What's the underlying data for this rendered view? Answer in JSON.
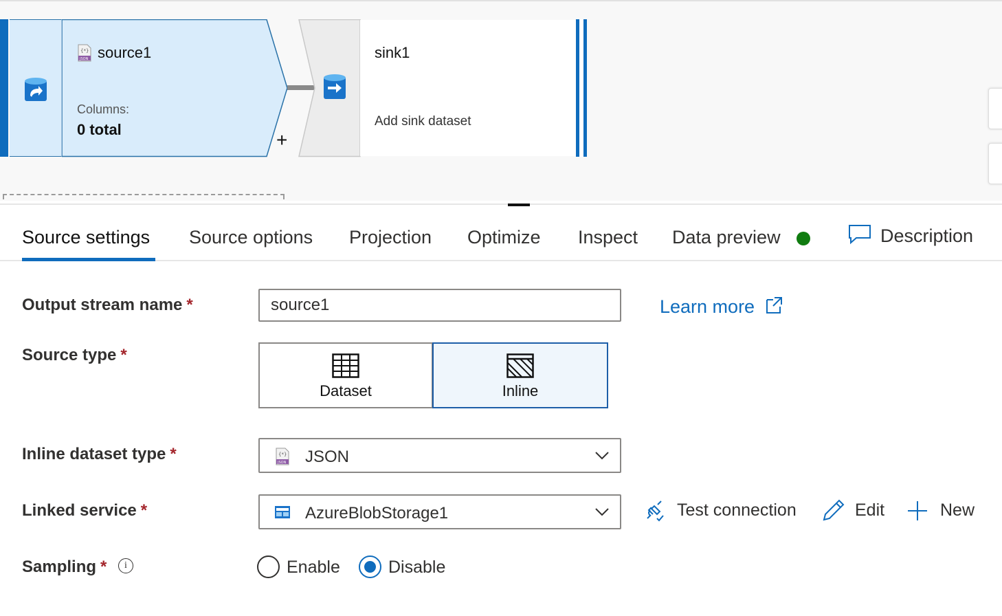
{
  "canvas": {
    "source": {
      "title": "source1",
      "columns_label": "Columns:",
      "columns_value": "0 total",
      "icon": "json-file-icon"
    },
    "add_button": "+",
    "sink": {
      "title": "sink1",
      "subtitle": "Add sink dataset"
    }
  },
  "tabs": [
    {
      "label": "Source settings",
      "active": true
    },
    {
      "label": "Source options"
    },
    {
      "label": "Projection"
    },
    {
      "label": "Optimize"
    },
    {
      "label": "Inspect"
    },
    {
      "label": "Data preview",
      "status_color": "#107c10"
    },
    {
      "label": "Description",
      "icon": "comment-icon"
    }
  ],
  "form": {
    "output_stream": {
      "label": "Output stream name",
      "required": "*",
      "value": "source1"
    },
    "learn_more": "Learn more",
    "source_type": {
      "label": "Source type",
      "required": "*",
      "options": [
        "Dataset",
        "Inline"
      ],
      "selected": "Inline"
    },
    "inline_dataset_type": {
      "label": "Inline dataset type",
      "required": "*",
      "value": "JSON"
    },
    "linked_service": {
      "label": "Linked service",
      "required": "*",
      "value": "AzureBlobStorage1",
      "actions": {
        "test": "Test connection",
        "edit": "Edit",
        "new": "New"
      }
    },
    "sampling": {
      "label": "Sampling",
      "required": "*",
      "options": [
        "Enable",
        "Disable"
      ],
      "selected": "Disable"
    }
  },
  "colors": {
    "accent": "#0f6cbd",
    "required": "#a4262c",
    "selected_bg": "#eff6fc",
    "source_node_bg": "#d9ecfb"
  }
}
